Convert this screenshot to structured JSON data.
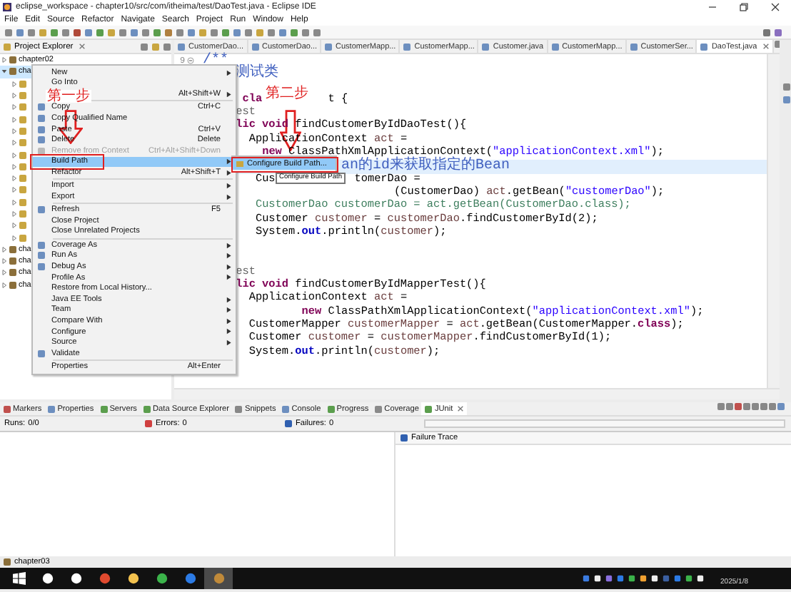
{
  "window": {
    "title": "eclipse_workspace - chapter10/src/com/itheima/test/DaoTest.java - Eclipse IDE"
  },
  "menu_bar": [
    "File",
    "Edit",
    "Source",
    "Refactor",
    "Navigate",
    "Search",
    "Project",
    "Run",
    "Window",
    "Help"
  ],
  "project_explorer": {
    "title": "Project Explorer",
    "projects": [
      {
        "name": "chapter02",
        "expanded": false,
        "selected": false
      },
      {
        "name": "cha",
        "expanded": true,
        "selected": true,
        "children": [
          {
            "expanded": false
          },
          {
            "expanded": false
          },
          {
            "expanded": false
          },
          {
            "expanded": false
          },
          {
            "expanded": false
          },
          {
            "expanded": false
          },
          {
            "expanded": false
          },
          {
            "expanded": false
          },
          {
            "expanded": false
          },
          {
            "expanded": false
          },
          {
            "expanded": false
          },
          {
            "expanded": false
          },
          {
            "expanded": false
          },
          {
            "expanded": false
          }
        ]
      },
      {
        "name": "cha",
        "expanded": false,
        "selected": false
      },
      {
        "name": "cha",
        "expanded": false,
        "selected": false
      },
      {
        "name": "cha",
        "expanded": false,
        "selected": false
      },
      {
        "name": "cha",
        "expanded": false,
        "selected": false
      }
    ]
  },
  "editor": {
    "tabs": [
      {
        "label": "CustomerDao...",
        "selected": false
      },
      {
        "label": "CustomerDao...",
        "selected": false
      },
      {
        "label": "CustomerMapp...",
        "selected": false
      },
      {
        "label": "CustomerMapp...",
        "selected": false
      },
      {
        "label": "Customer.java",
        "selected": false
      },
      {
        "label": "CustomerMapp...",
        "selected": false
      },
      {
        "label": "CustomerSer...",
        "selected": false
      },
      {
        "label": "DaoTest.java",
        "selected": true
      }
    ],
    "lines": [
      {
        "number": "9",
        "current": false,
        "segments": [
          {
            "text": "/**",
            "kind": "doc"
          }
        ]
      },
      {
        "current": false,
        "segments": [
          {
            "text": "     测试类",
            "kind": "doc"
          }
        ]
      },
      {
        "current": false
      },
      {
        "current": false,
        "segments": [
          {
            "text": "      cla",
            "kind": "keyword"
          },
          {
            "text": "          t {",
            "kind": "plain"
          }
        ]
      },
      {
        "current": false,
        "segments": [
          {
            "text": "     est",
            "kind": "annotation"
          }
        ]
      },
      {
        "current": false,
        "segments": [
          {
            "text": "     lic void",
            "kind": "keyword"
          },
          {
            "text": " findCustomerByIdDaoTest(){",
            "kind": "plain"
          }
        ]
      },
      {
        "current": false,
        "segments": [
          {
            "text": "       ApplicationContext ",
            "kind": "plain"
          },
          {
            "text": "act",
            "kind": "local"
          },
          {
            "text": " =",
            "kind": "plain"
          }
        ]
      },
      {
        "current": false,
        "segments": [
          {
            "text": "         new",
            "kind": "keyword"
          },
          {
            "text": " ClassPathXmlApplicationContext(",
            "kind": "plain"
          },
          {
            "text": "\"applicationContext.xml\"",
            "kind": "string"
          },
          {
            "text": ");",
            "kind": "plain"
          }
        ]
      },
      {
        "current": true,
        "segments": [
          {
            "text": "                     an的id来获取指定的Bean",
            "kind": "doc"
          }
        ]
      },
      {
        "current": false,
        "segments": [
          {
            "text": "        Cus",
            "kind": "plain"
          },
          {
            "text": "            tomerDao =",
            "kind": "plain"
          }
        ]
      },
      {
        "current": false,
        "segments": [
          {
            "text": "                             (CustomerDao) ",
            "kind": "plain"
          },
          {
            "text": "act",
            "kind": "local"
          },
          {
            "text": ".getBean(",
            "kind": "plain"
          },
          {
            "text": "\"customerDao\"",
            "kind": "string"
          },
          {
            "text": ");",
            "kind": "plain"
          }
        ]
      },
      {
        "current": false,
        "segments": [
          {
            "text": "        CustomerDao customerDao = act.getBean(CustomerDao.class);",
            "kind": "comment"
          }
        ]
      },
      {
        "current": false,
        "segments": [
          {
            "text": "        Customer ",
            "kind": "plain"
          },
          {
            "text": "customer",
            "kind": "local"
          },
          {
            "text": " = ",
            "kind": "plain"
          },
          {
            "text": "customerDao",
            "kind": "local"
          },
          {
            "text": ".findCustomerById(2);",
            "kind": "plain"
          }
        ]
      },
      {
        "current": false,
        "segments": [
          {
            "text": "        System.",
            "kind": "plain"
          },
          {
            "text": "out",
            "kind": "field"
          },
          {
            "text": ".println(",
            "kind": "plain"
          },
          {
            "text": "customer",
            "kind": "local"
          },
          {
            "text": ");",
            "kind": "plain"
          }
        ]
      },
      {
        "current": false
      },
      {
        "current": false
      },
      {
        "current": false,
        "segments": [
          {
            "text": "     est",
            "kind": "annotation"
          }
        ]
      },
      {
        "current": false,
        "segments": [
          {
            "text": "     lic void",
            "kind": "keyword"
          },
          {
            "text": " findCustomerByIdMapperTest(){",
            "kind": "plain"
          }
        ]
      },
      {
        "current": false,
        "segments": [
          {
            "text": "       ApplicationContext ",
            "kind": "plain"
          },
          {
            "text": "act",
            "kind": "local"
          },
          {
            "text": " =",
            "kind": "plain"
          }
        ]
      },
      {
        "current": false,
        "segments": [
          {
            "text": "               new",
            "kind": "keyword"
          },
          {
            "text": " ClassPathXmlApplicationContext(",
            "kind": "plain"
          },
          {
            "text": "\"applicationContext.xml\"",
            "kind": "string"
          },
          {
            "text": ");",
            "kind": "plain"
          }
        ]
      },
      {
        "current": false,
        "segments": [
          {
            "text": "       CustomerMapper ",
            "kind": "plain"
          },
          {
            "text": "customerMapper",
            "kind": "local"
          },
          {
            "text": " = ",
            "kind": "plain"
          },
          {
            "text": "act",
            "kind": "local"
          },
          {
            "text": ".getBean(CustomerMapper.",
            "kind": "plain"
          },
          {
            "text": "class",
            "kind": "keyword"
          },
          {
            "text": ");",
            "kind": "plain"
          }
        ]
      },
      {
        "current": false,
        "segments": [
          {
            "text": "       Customer ",
            "kind": "plain"
          },
          {
            "text": "customer",
            "kind": "local"
          },
          {
            "text": " = ",
            "kind": "plain"
          },
          {
            "text": "customerMapper",
            "kind": "local"
          },
          {
            "text": ".findCustomerById(1);",
            "kind": "plain"
          }
        ]
      },
      {
        "current": false,
        "segments": [
          {
            "text": "       System.",
            "kind": "plain"
          },
          {
            "text": "out",
            "kind": "field"
          },
          {
            "text": ".println(",
            "kind": "plain"
          },
          {
            "text": "customer",
            "kind": "local"
          },
          {
            "text": ");",
            "kind": "plain"
          }
        ]
      }
    ]
  },
  "context_menu": {
    "items": [
      {
        "kind": "item",
        "label": "New",
        "submenu": true,
        "icon": false,
        "disabled": false,
        "selected": false
      },
      {
        "kind": "item",
        "label": "Go Into",
        "submenu": false,
        "icon": false,
        "disabled": false,
        "selected": false
      },
      {
        "kind": "item",
        "shortcut": "Alt+Shift+W",
        "submenu": true,
        "icon": false,
        "disabled": false,
        "selected": false
      },
      {
        "kind": "separator"
      },
      {
        "kind": "item",
        "label": "Copy",
        "shortcut": "Ctrl+C",
        "submenu": false,
        "icon": true,
        "disabled": false,
        "selected": false
      },
      {
        "kind": "item",
        "label": "Copy Qualified Name",
        "submenu": false,
        "icon": true,
        "disabled": false,
        "selected": false
      },
      {
        "kind": "item",
        "label": "Paste",
        "shortcut": "Ctrl+V",
        "submenu": false,
        "icon": true,
        "disabled": false,
        "selected": false
      },
      {
        "kind": "item",
        "label": "Delete",
        "shortcut": "Delete",
        "submenu": false,
        "icon": true,
        "disabled": false,
        "selected": false
      },
      {
        "kind": "item",
        "label": "Remove from Context",
        "shortcut": "Ctrl+Alt+Shift+Down",
        "submenu": false,
        "icon": true,
        "disabled": true,
        "selected": false
      },
      {
        "kind": "item",
        "label": "Build Path",
        "submenu": true,
        "icon": false,
        "disabled": false,
        "selected": true
      },
      {
        "kind": "item",
        "label": "Refactor",
        "shortcut": "Alt+Shift+T",
        "submenu": true,
        "icon": false,
        "disabled": false,
        "selected": false
      },
      {
        "kind": "separator"
      },
      {
        "kind": "item",
        "label": "Import",
        "submenu": true,
        "icon": false,
        "disabled": false,
        "selected": false
      },
      {
        "kind": "item",
        "label": "Export",
        "submenu": true,
        "icon": false,
        "disabled": false,
        "selected": false
      },
      {
        "kind": "separator"
      },
      {
        "kind": "item",
        "label": "Refresh",
        "shortcut": "F5",
        "submenu": false,
        "icon": true,
        "disabled": false,
        "selected": false
      },
      {
        "kind": "item",
        "label": "Close Project",
        "submenu": false,
        "icon": false,
        "disabled": false,
        "selected": false
      },
      {
        "kind": "item",
        "label": "Close Unrelated Projects",
        "submenu": false,
        "icon": false,
        "disabled": false,
        "selected": false
      },
      {
        "kind": "separator"
      },
      {
        "kind": "item",
        "label": "Coverage As",
        "submenu": true,
        "icon": true,
        "disabled": false,
        "selected": false
      },
      {
        "kind": "item",
        "label": "Run As",
        "submenu": true,
        "icon": true,
        "disabled": false,
        "selected": false
      },
      {
        "kind": "item",
        "label": "Debug As",
        "submenu": true,
        "icon": true,
        "disabled": false,
        "selected": false
      },
      {
        "kind": "item",
        "label": "Profile As",
        "submenu": true,
        "icon": false,
        "disabled": false,
        "selected": false
      },
      {
        "kind": "item",
        "label": "Restore from Local History...",
        "submenu": false,
        "icon": false,
        "disabled": false,
        "selected": false
      },
      {
        "kind": "item",
        "label": "Java EE Tools",
        "submenu": true,
        "icon": false,
        "disabled": false,
        "selected": false
      },
      {
        "kind": "item",
        "label": "Team",
        "submenu": true,
        "icon": false,
        "disabled": false,
        "selected": false
      },
      {
        "kind": "item",
        "label": "Compare With",
        "submenu": true,
        "icon": false,
        "disabled": false,
        "selected": false
      },
      {
        "kind": "item",
        "label": "Configure",
        "submenu": true,
        "icon": false,
        "disabled": false,
        "selected": false
      },
      {
        "kind": "item",
        "label": "Source",
        "submenu": true,
        "icon": false,
        "disabled": false,
        "selected": false
      },
      {
        "kind": "item",
        "label": "Validate",
        "submenu": false,
        "icon": true,
        "disabled": false,
        "selected": false
      },
      {
        "kind": "separator"
      },
      {
        "kind": "item",
        "label": "Properties",
        "shortcut": "Alt+Enter",
        "submenu": false,
        "icon": false,
        "disabled": false,
        "selected": false
      }
    ]
  },
  "submenu": {
    "items": [
      {
        "label": "Configure Build Path...",
        "selected": true
      }
    ]
  },
  "tooltip": "Configure Build Path",
  "annotations": [
    "第一步",
    "第二步"
  ],
  "bottom_panel": {
    "tabs": [
      {
        "label": "Markers",
        "selected": false
      },
      {
        "label": "Properties",
        "selected": false
      },
      {
        "label": "Servers",
        "selected": false
      },
      {
        "label": "Data Source Explorer",
        "selected": false
      },
      {
        "label": "Snippets",
        "selected": false
      },
      {
        "label": "Console",
        "selected": false
      },
      {
        "label": "Progress",
        "selected": false
      },
      {
        "label": "Coverage",
        "selected": false
      },
      {
        "label": "JUnit",
        "selected": true
      }
    ],
    "runs_label": "Runs:",
    "runs": "0/0",
    "errors_label": "Errors:",
    "errors": "0",
    "failures_label": "Failures:",
    "failures": "0",
    "failure_trace": "Failure Trace",
    "progress": {
      "level": 0
    }
  },
  "status_bar": "chapter03",
  "taskbar": {
    "apps": [
      {
        "selected": false
      },
      {
        "selected": false
      },
      {
        "selected": false
      },
      {
        "selected": false
      },
      {
        "selected": false
      },
      {
        "selected": false
      },
      {
        "selected": true
      }
    ],
    "date": "2025/1/8"
  }
}
